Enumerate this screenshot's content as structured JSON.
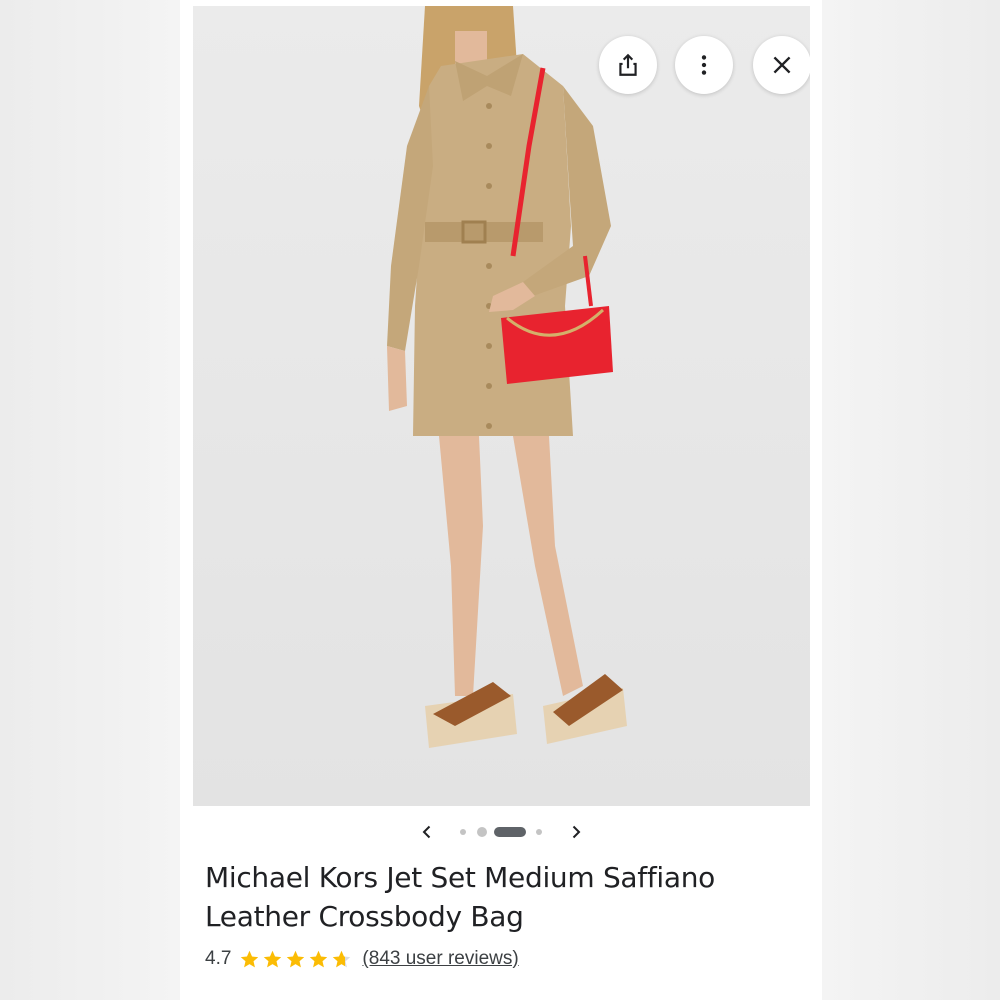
{
  "product": {
    "title": "Michael Kors Jet Set Medium Saffiano Leather Crossbody Bag",
    "rating_value": "4.7",
    "rating_stars": 4.7,
    "reviews_link": "(843 user reviews)"
  },
  "toolbar": {
    "share_icon": "share-icon",
    "more_icon": "more-vert-icon",
    "close_icon": "close-icon"
  },
  "carousel": {
    "prev_icon": "chevron-left-icon",
    "next_icon": "chevron-right-icon",
    "slide_count": 4,
    "active_index": 2
  },
  "colors": {
    "star": "#fbbc04",
    "bag": "#e8232f",
    "dress": "#c9ad82"
  }
}
